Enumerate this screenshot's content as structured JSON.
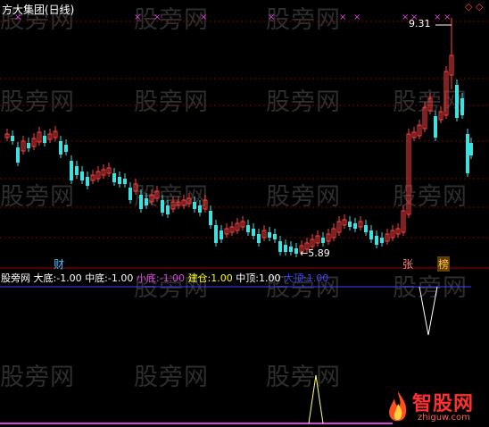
{
  "title": "方大集团(日线)",
  "watermark": "股旁网",
  "price_labels": {
    "high": "9.31",
    "low": "5.89"
  },
  "event_labels": {
    "cai": "财",
    "zhang": "张",
    "bang": "榜"
  },
  "indicator": {
    "name": "股旁网",
    "items": [
      {
        "label": "大底:",
        "value": "-1.00",
        "color": "#ffffff"
      },
      {
        "label": "中底:",
        "value": "-1.00",
        "color": "#ffffff"
      },
      {
        "label": "小底:",
        "value": "-1.00",
        "color": "#e040e0"
      },
      {
        "label": "建仓:",
        "value": "1.00",
        "color": "#ffff00"
      },
      {
        "label": "中顶:",
        "value": "1.00",
        "color": "#ffffff"
      },
      {
        "label": "大顶:",
        "value": "1.00",
        "color": "#4040ff"
      }
    ]
  },
  "logo": {
    "name": "智股网",
    "url": "zhiguw.com"
  },
  "colors": {
    "up": "#ff4040",
    "down": "#40e0e0",
    "grid": "#800000",
    "marker": "#e040e0"
  },
  "chart_data": {
    "type": "candlestick",
    "price_high": 9.31,
    "price_low": 5.89
  }
}
